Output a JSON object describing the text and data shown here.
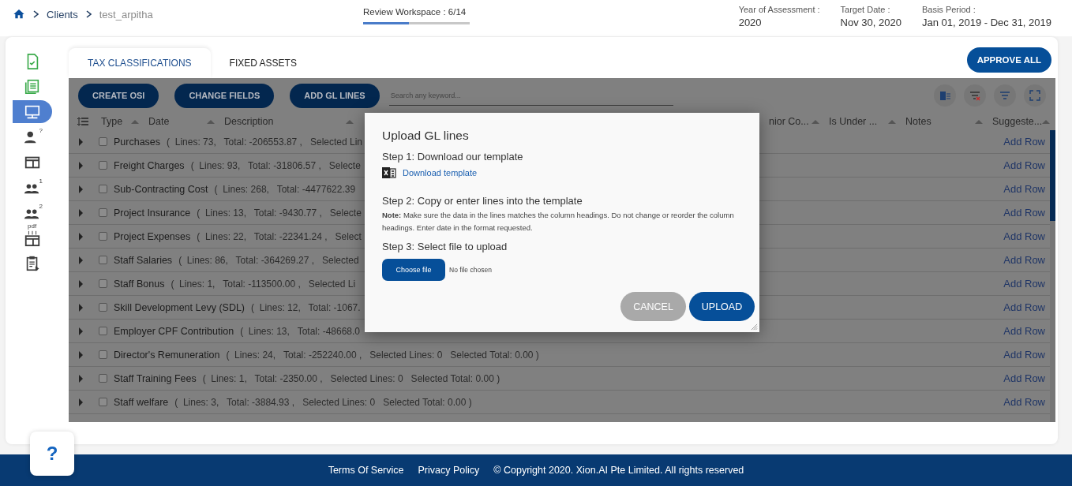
{
  "breadcrumb": {
    "items": [
      {
        "label": "Clients",
        "current": false
      },
      {
        "label": "test_arpitha",
        "current": true
      }
    ]
  },
  "progress": {
    "label": "Review Workspace : 6/14",
    "level": 0.43
  },
  "info": [
    {
      "label": "Year of Assessment :",
      "value": "2020"
    },
    {
      "label": "Target Date :",
      "value": "Nov 30, 2020"
    },
    {
      "label": "Basis Period :",
      "value": "Jan 01, 2019 - Dec 31, 2019"
    }
  ],
  "sidebar": {
    "items": [
      {
        "kind": "doc-check",
        "selected": false
      },
      {
        "kind": "list",
        "selected": false
      },
      {
        "kind": "monitor",
        "selected": true
      },
      {
        "kind": "user-question",
        "badge": "?",
        "selected": false
      },
      {
        "kind": "panel",
        "selected": false
      },
      {
        "kind": "users-1",
        "badge": "1",
        "selected": false
      },
      {
        "kind": "users-2",
        "badge": "2",
        "selected": false
      },
      {
        "kind": "pdf-panel",
        "badge": "pdf",
        "selected": false
      },
      {
        "kind": "clipboard",
        "selected": false
      }
    ]
  },
  "tabs": [
    {
      "label": "TAX CLASSIFICATIONS",
      "selected": true
    },
    {
      "label": "FIXED ASSETS",
      "selected": false
    }
  ],
  "approve_button": "APPROVE ALL",
  "toolbar": {
    "buttons": [
      "CREATE OSI",
      "CHANGE FIELDS",
      "ADD GL LINES"
    ],
    "search": {
      "placeholder": "Search any keyword..."
    }
  },
  "table": {
    "columns": [
      {
        "label": "Type",
        "kind": "left"
      },
      {
        "label": "Date",
        "kind": "left"
      },
      {
        "label": "Description",
        "kind": "left"
      },
      {
        "label": "nior Co...",
        "kind": "right"
      },
      {
        "label": "Is Under ...",
        "kind": "right"
      },
      {
        "label": "Notes",
        "kind": "right"
      },
      {
        "label": "Suggeste...",
        "kind": "right"
      }
    ],
    "rows": [
      {
        "name": "Purchases",
        "summary": "(  Lines: 73,   Total: -206553.87 ,   Selected Lin",
        "checked": false,
        "action": "Add Row"
      },
      {
        "name": "Freight Charges",
        "summary": "(  Lines: 93,   Total: -31806.57 ,   Selecte",
        "checked": false,
        "action": "Add Row"
      },
      {
        "name": "Sub-Contracting Cost",
        "summary": "(  Lines: 268,   Total: -4477622.39",
        "checked": false,
        "action": "Add Row"
      },
      {
        "name": "Project Insurance",
        "summary": "(  Lines: 13,   Total: -9430.77 ,   Selecte",
        "checked": false,
        "action": "Add Row"
      },
      {
        "name": "Project Expenses",
        "summary": "(  Lines: 22,   Total: -22341.24 ,   Select",
        "checked": false,
        "action": "Add Row"
      },
      {
        "name": "Staff Salaries",
        "summary": "(  Lines: 86,   Total: -364269.27 ,   Selected",
        "checked": false,
        "action": "Add Row"
      },
      {
        "name": "Staff Bonus",
        "summary": "(  Lines: 1,   Total: -113500.00 ,   Selected Li",
        "checked": false,
        "action": "Add Row"
      },
      {
        "name": "Skill Development Levy (SDL)",
        "summary": "(  Lines: 12,   Total: -1067.",
        "checked": false,
        "action": "Add Row"
      },
      {
        "name": "Employer CPF Contribution",
        "summary": "(  Lines: 13,   Total: -48668.0",
        "checked": false,
        "action": "Add Row"
      },
      {
        "name": "Director's Remuneration",
        "summary": "(  Lines: 24,   Total: -252240.00 ,   Selected Lines: 0   Selected Total: 0.00 )",
        "checked": false,
        "action": "Add Row"
      },
      {
        "name": "Staff Training Fees",
        "summary": "(  Lines: 1,   Total: -2350.00 ,   Selected Lines: 0   Selected Total: 0.00 )",
        "checked": false,
        "action": "Add Row"
      },
      {
        "name": "Staff welfare",
        "summary": "(  Lines: 3,   Total: -3884.93 ,   Selected Lines: 0   Selected Total: 0.00 )",
        "checked": false,
        "action": "Add Row"
      }
    ]
  },
  "dialog": {
    "title": "Upload GL lines",
    "step1": "Step 1: Download our template",
    "download_link": "Download template",
    "step2": "Step 2: Copy or enter lines into the template",
    "note": "**Note:** Make sure the data in the lines matches the column headings. Do not change or reorder the column headings. Enter date in the format requested.",
    "step3": "Step 3: Select file to upload",
    "file_button": "Choose file",
    "file_status": "No file chosen",
    "buttons": [
      {
        "label": "CANCEL",
        "disabled": true
      },
      {
        "label": "UPLOAD",
        "disabled": false
      }
    ]
  },
  "footer": {
    "links": [
      "Terms Of Service",
      "Privacy Policy"
    ],
    "copyright": "© Copyright 2020. Xion.AI Pte Limited. All rights reserved"
  },
  "help_button": "?"
}
